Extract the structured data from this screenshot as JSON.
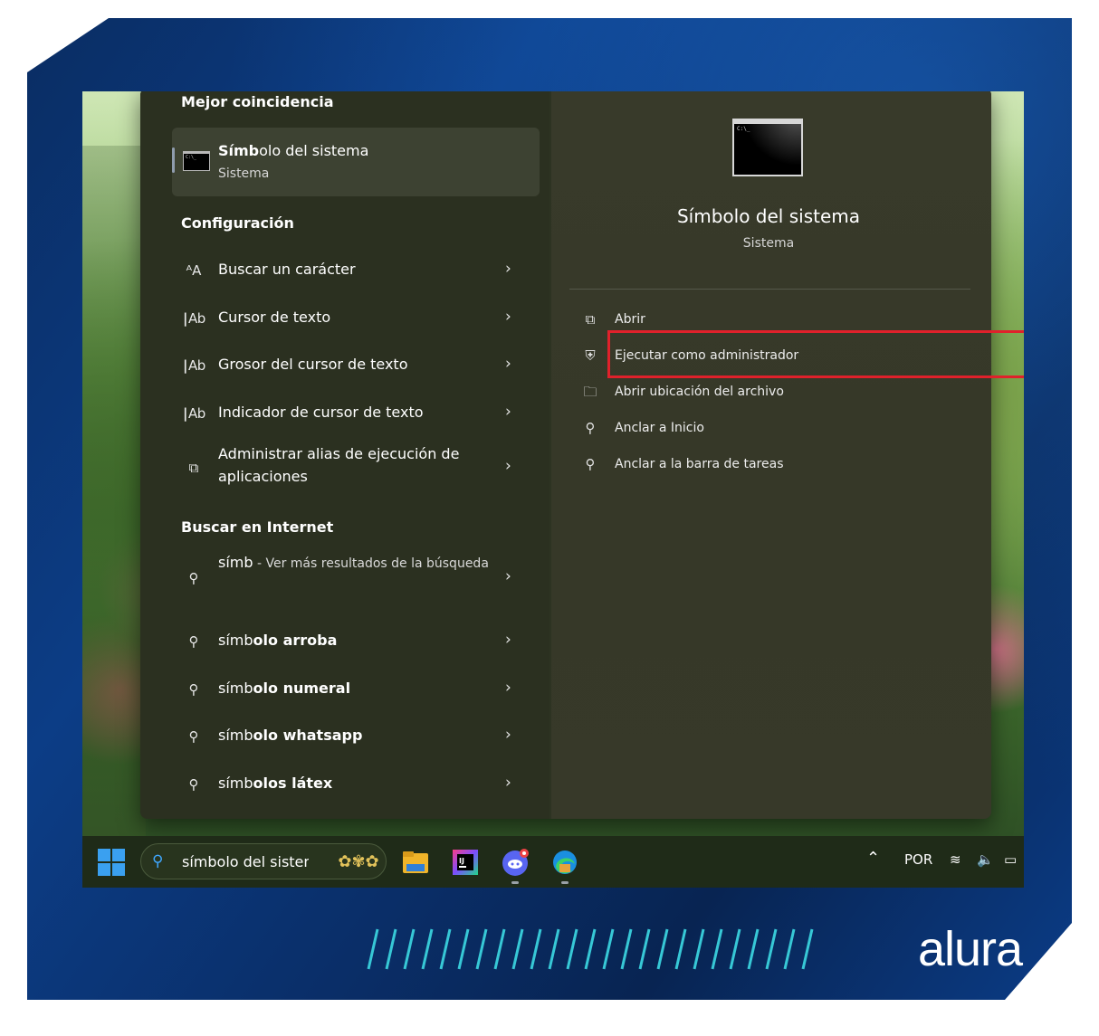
{
  "left": {
    "best_match_header": "Mejor coincidencia",
    "best_match": {
      "title": "Símbolo del sistema",
      "subtitle": "Sistema"
    },
    "settings_header": "Configuración",
    "settings_items": [
      {
        "label": "Buscar un carácter",
        "icon": "character-icon"
      },
      {
        "label": "Cursor de texto",
        "icon": "text-cursor-icon"
      },
      {
        "label": "Grosor del cursor de texto",
        "icon": "text-cursor-icon"
      },
      {
        "label": "Indicador de cursor de texto",
        "icon": "text-cursor-icon"
      },
      {
        "label": "Administrar alias de ejecución de aplicaciones",
        "icon": "app-alias-icon"
      }
    ],
    "web_header": "Buscar en Internet",
    "web_items": [
      {
        "bold": "símb",
        "rest": " - Ver más resultados de la búsqueda"
      },
      {
        "bold": "símb",
        "rest": "olo arroba"
      },
      {
        "bold": "símb",
        "rest": "olo numeral"
      },
      {
        "bold": "símb",
        "rest": "olo whatsapp"
      },
      {
        "bold": "símb",
        "rest": "olos látex"
      }
    ]
  },
  "right": {
    "title": "Símbolo del sistema",
    "subtitle": "Sistema",
    "actions": [
      {
        "label": "Abrir",
        "icon": "open-external-icon"
      },
      {
        "label": "Ejecutar como administrador",
        "icon": "admin-shield-icon"
      },
      {
        "label": "Abrir ubicación del archivo",
        "icon": "folder-icon"
      },
      {
        "label": "Anclar a Inicio",
        "icon": "pin-icon"
      },
      {
        "label": "Anclar a la barra de tareas",
        "icon": "pin-icon"
      }
    ]
  },
  "taskbar": {
    "search_text": "símbolo del sistema",
    "apps": [
      "file-explorer",
      "intellij-idea",
      "discord",
      "microsoft-edge"
    ],
    "tray_language": "POR"
  },
  "brand": {
    "logo_text": "alura"
  },
  "colors": {
    "highlight_border": "#e0212b",
    "accent_blue": "#3aa0f0"
  }
}
